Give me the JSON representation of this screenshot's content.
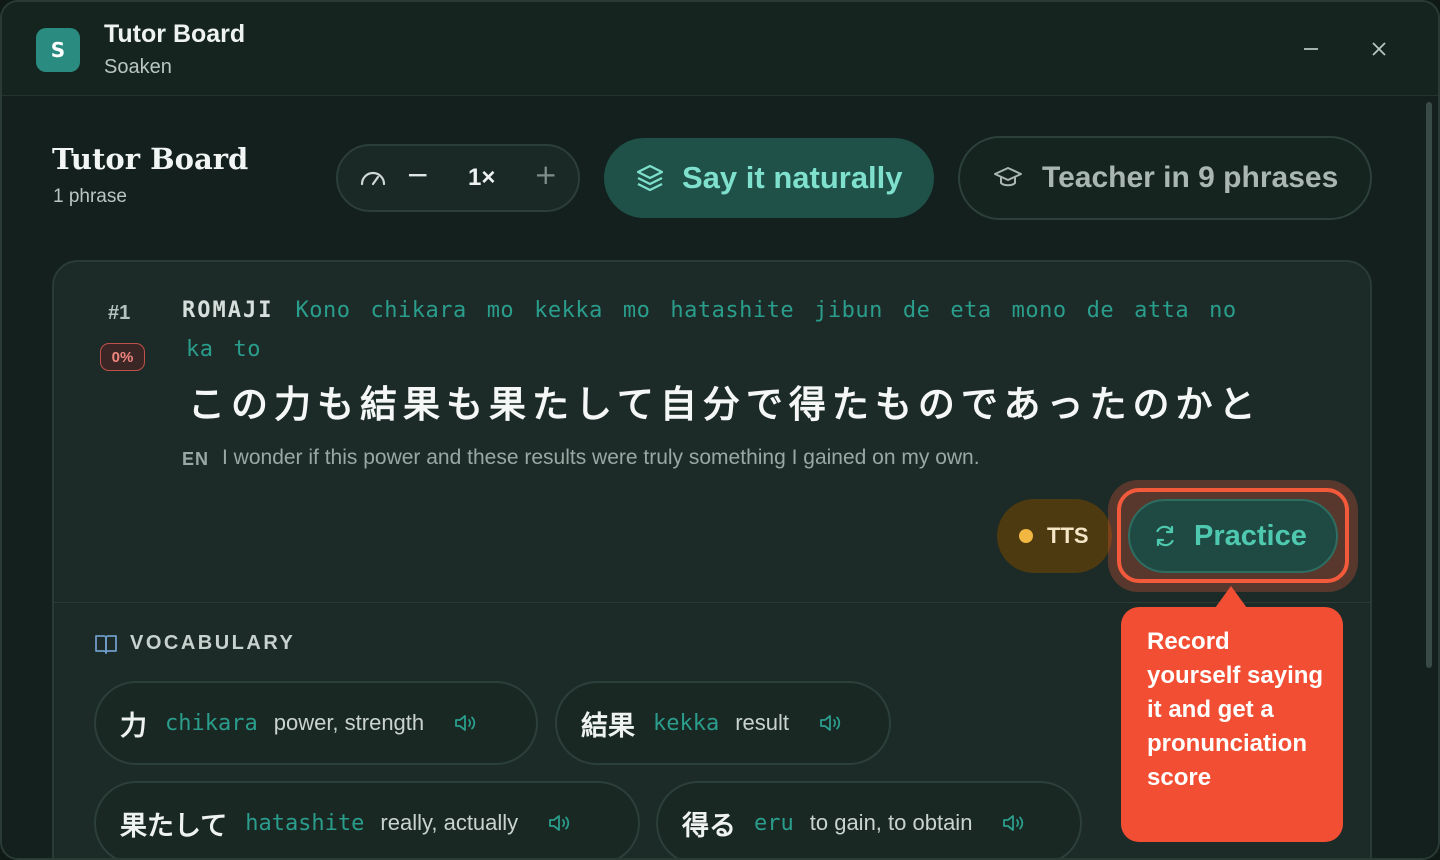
{
  "window": {
    "logo_letter": "S",
    "title": "Tutor Board",
    "subtitle": "Soaken",
    "minimize_glyph": "—",
    "close_glyph": "✕"
  },
  "header": {
    "title": "Tutor Board",
    "subtitle": "1 phrase",
    "speed": {
      "minus": "−",
      "value": "1×",
      "plus": "+"
    },
    "say_naturally_label": "Say it naturally",
    "teacher_label": "Teacher in 9 phrases"
  },
  "phrase": {
    "number": "#1",
    "score": "0%",
    "romaji_label": "ROMAJI",
    "romaji_line1": [
      "Kono",
      "chikara",
      "mo",
      "kekka",
      "mo",
      "hatashite",
      "jibun",
      "de",
      "eta",
      "mono",
      "de",
      "atta",
      "no"
    ],
    "romaji_line2": [
      "ka",
      "to"
    ],
    "japanese": "この力も結果も果たして自分で得たものであったのかと",
    "en_tag": "EN",
    "english": "I wonder if this power and these results were truly something I gained on my own.",
    "tts_label": "TTS",
    "practice_label": "Practice"
  },
  "tooltip": {
    "text": "Record yourself saying it and get a pronunciation score"
  },
  "vocabulary": {
    "heading": "VOCABULARY",
    "items": [
      {
        "kanji": "力",
        "reading": "chikara",
        "meaning": "power, strength"
      },
      {
        "kanji": "結果",
        "reading": "kekka",
        "meaning": "result"
      },
      {
        "kanji": "果たして",
        "reading": "hatashite",
        "meaning": "really, actually"
      },
      {
        "kanji": "得る",
        "reading": "eru",
        "meaning": "to gain, to obtain"
      }
    ]
  },
  "colors": {
    "accent_teal": "#2a9d8c",
    "practice_teal": "#4ec9b0",
    "highlight_red": "#f35a3b",
    "tts_amber": "#f2b643"
  },
  "icons": {
    "speed": "gauge-icon",
    "say_naturally": "layers-icon",
    "teacher": "graduation-cap-icon",
    "practice": "refresh-icon",
    "vocabulary": "book-icon",
    "speaker": "speaker-icon"
  }
}
